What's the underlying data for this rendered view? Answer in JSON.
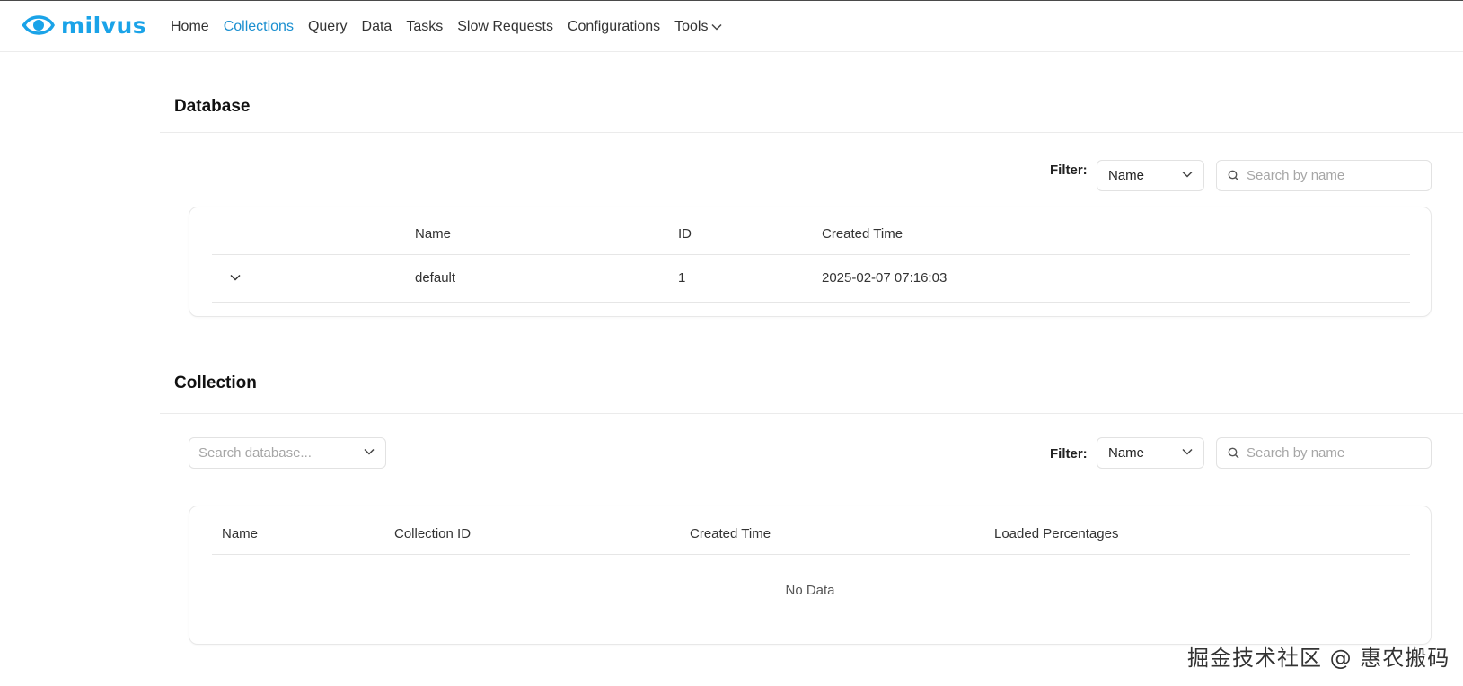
{
  "app": {
    "logo_text": "milvus",
    "brand_color": "#1aa3e8"
  },
  "nav": {
    "items": [
      {
        "label": "Home",
        "active": false
      },
      {
        "label": "Collections",
        "active": true
      },
      {
        "label": "Query",
        "active": false
      },
      {
        "label": "Data",
        "active": false
      },
      {
        "label": "Tasks",
        "active": false
      },
      {
        "label": "Slow Requests",
        "active": false
      },
      {
        "label": "Configurations",
        "active": false
      },
      {
        "label": "Tools",
        "active": false,
        "has_dropdown": true
      }
    ]
  },
  "database_section": {
    "title": "Database",
    "filter_label": "Filter:",
    "filter_value": "Name",
    "search_placeholder": "Search by name",
    "columns": [
      "Name",
      "ID",
      "Created Time"
    ],
    "rows": [
      {
        "name": "default",
        "id": "1",
        "created_time": "2025-02-07 07:16:03"
      }
    ]
  },
  "collection_section": {
    "title": "Collection",
    "db_search_placeholder": "Search database...",
    "filter_label": "Filter:",
    "filter_value": "Name",
    "search_placeholder": "Search by name",
    "columns": [
      "Name",
      "Collection ID",
      "Created Time",
      "Loaded Percentages"
    ],
    "empty_text": "No Data"
  },
  "watermark": "掘金技术社区 @ 惠农搬码",
  "icons": [
    "milvus-eye-logo-icon",
    "chevron-down-icon",
    "search-icon"
  ]
}
